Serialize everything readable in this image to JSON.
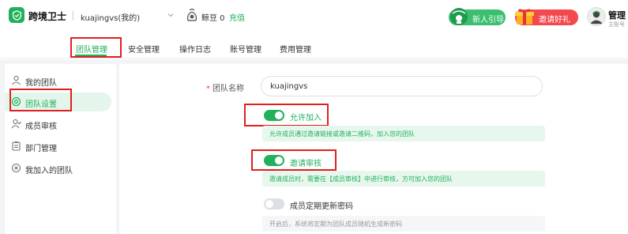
{
  "app": {
    "name": "跨境卫士",
    "account": "kuajingvs(我的)",
    "beans": "鲸豆 0",
    "recharge": "充值",
    "guide_button": "新人引导",
    "invite_button": "邀请好礼",
    "user_title": "管理",
    "user_subtitle": "主账号"
  },
  "nav": {
    "tabs": [
      {
        "label": "团队管理",
        "active": true
      },
      {
        "label": "安全管理",
        "active": false
      },
      {
        "label": "操作日志",
        "active": false
      },
      {
        "label": "账号管理",
        "active": false
      },
      {
        "label": "费用管理",
        "active": false
      }
    ]
  },
  "sidebar": {
    "items": [
      {
        "label": "我的团队",
        "icon": "team-icon",
        "active": false
      },
      {
        "label": "团队设置",
        "icon": "settings-icon",
        "active": true
      },
      {
        "label": "成员审核",
        "icon": "user-check-icon",
        "active": false
      },
      {
        "label": "部门管理",
        "icon": "clipboard-icon",
        "active": false
      },
      {
        "label": "我加入的团队",
        "icon": "joined-team-icon",
        "active": false
      }
    ]
  },
  "form": {
    "team_name_label": "团队名称",
    "team_name_value": "kuajingvs",
    "allow_join": {
      "label": "允许加入",
      "enabled": true,
      "hint": "允许成员通过邀请链接或邀请二维码，加入您的团队"
    },
    "invite_review": {
      "label": "邀请审核",
      "enabled": true,
      "hint": "邀请成员时，需要在【成员审核】中进行审核，方可加入您的团队"
    },
    "password_rotation": {
      "label": "成员定期更新密码",
      "enabled": false,
      "hint": "开启后，系统将定期为团队成员随机生成新密码"
    }
  },
  "colors": {
    "accent": "#20b15a",
    "highlight": "#e02020",
    "invite": "#f3484e"
  }
}
